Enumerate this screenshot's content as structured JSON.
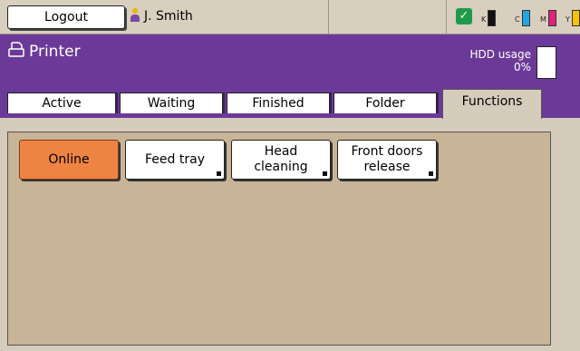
{
  "topbar": {
    "logout_label": "Logout",
    "user_name": "J. Smith",
    "inks": [
      {
        "letter": "K",
        "color": "#111111",
        "level": 0.9
      },
      {
        "letter": "C",
        "color": "#22a7e0",
        "level": 0.9
      },
      {
        "letter": "M",
        "color": "#e0227a",
        "level": 0.9
      },
      {
        "letter": "Y",
        "color": "#f3c400",
        "level": 0.9
      }
    ]
  },
  "header": {
    "title": "Printer",
    "hdd_label": "HDD usage",
    "hdd_value": "0%"
  },
  "tabs": [
    {
      "label": "Active"
    },
    {
      "label": "Waiting"
    },
    {
      "label": "Finished"
    },
    {
      "label": "Folder"
    },
    {
      "label": "Functions",
      "selected": true
    }
  ],
  "functions": [
    {
      "label": "Online",
      "active": true
    },
    {
      "label": "Feed tray"
    },
    {
      "label": "Head\ncleaning"
    },
    {
      "label": "Front doors\nrelease"
    }
  ],
  "colors": {
    "header_purple": "#6b3a98",
    "online_orange": "#ee8444",
    "content_tan": "#c8b497",
    "status_green": "#1f9a4a"
  }
}
